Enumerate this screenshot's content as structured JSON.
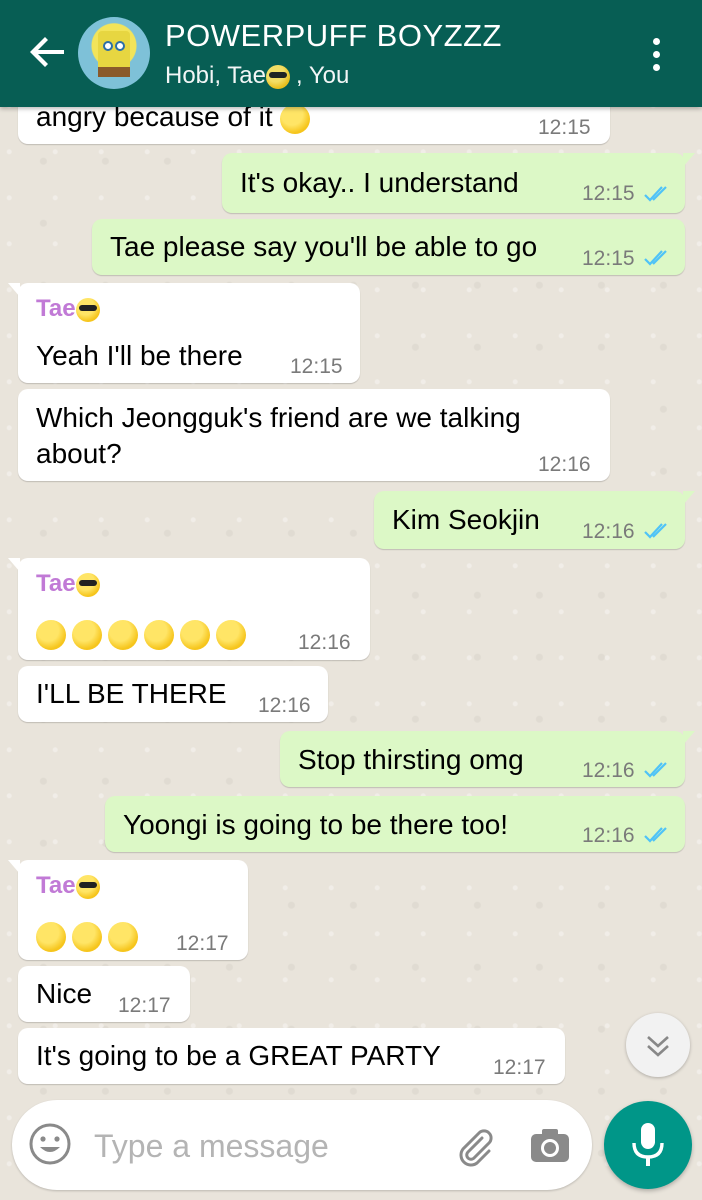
{
  "header": {
    "title": "POWERPUFF BOYZZZ",
    "participants_prefix": "Hobi, Tae",
    "participants_suffix": ", You"
  },
  "messages": [
    {
      "direction": "in",
      "text": "angry because of it",
      "time": "12:15",
      "emoji": "frowning-face"
    },
    {
      "direction": "out",
      "text": "It's okay.. I understand",
      "time": "12:15",
      "read": true
    },
    {
      "direction": "out",
      "text": "Tae please say you'll be able to go",
      "time": "12:15",
      "read": true
    },
    {
      "direction": "in",
      "sender": "Tae",
      "text": "Yeah I'll be there",
      "time": "12:15"
    },
    {
      "direction": "in",
      "text_line1": "Which Jeongguk's friend are we talking",
      "text_line2": "about?",
      "time": "12:16"
    },
    {
      "direction": "out",
      "text": "Kim Seokjin",
      "time": "12:16",
      "read": true
    },
    {
      "direction": "in",
      "sender": "Tae",
      "emoji": "drooling x5, flushed x1",
      "time": "12:16"
    },
    {
      "direction": "in",
      "text": "I'LL BE THERE",
      "time": "12:16"
    },
    {
      "direction": "out",
      "text": "Stop thirsting omg",
      "time": "12:16",
      "read": true
    },
    {
      "direction": "out",
      "text": "Yoongi is going to be there too!",
      "time": "12:16",
      "read": true
    },
    {
      "direction": "in",
      "sender": "Tae",
      "emoji": "smirking x3",
      "time": "12:17"
    },
    {
      "direction": "in",
      "text": "Nice",
      "time": "12:17"
    },
    {
      "direction": "in",
      "text": "It's going to be a GREAT PARTY",
      "time": "12:17"
    }
  ],
  "input": {
    "placeholder": "Type a message"
  },
  "colors": {
    "header": "#075e54",
    "outgoing": "#dcf8c6",
    "incoming": "#ffffff",
    "mic": "#009688",
    "ticks": "#4fc3f7",
    "sender": "#c17ad6"
  }
}
